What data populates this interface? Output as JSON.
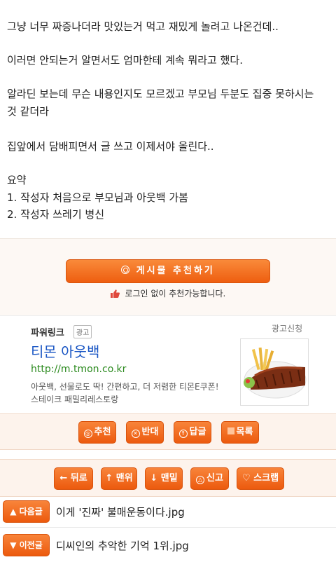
{
  "article": {
    "lines": [
      "그냥 너무 짜증나더라 맛있는거 먹고 재밌게 놀려고 나온건데..",
      "이러면 안되는거 알면서도 엄마한테 계속 뭐라고 했다.",
      "알라딘 보는데 무슨 내용인지도 모르겠고 부모님 두분도 집중 못하시는",
      "것 같더라",
      "집앞에서 담배피면서 글 쓰고 이제서야 올린다..",
      "요약",
      "1. 작성자 처음으로 부모님과 아웃백 가봄",
      "2. 작성자 쓰레기 병신"
    ]
  },
  "recommend": {
    "button_label": "게시물 추천하기",
    "note": "로그인 없이 추천가능합니다."
  },
  "ad": {
    "powerlink": "파워링크",
    "badge": "광고",
    "apply": "광고신청",
    "title": "티몬 아웃백",
    "url": "http://m.tmon.co.kr",
    "desc1": "아웃백, 선물로도 딱! 간편하고, 더 저렴한 티몬E쿠폰!",
    "desc2": "스테이크 패밀리레스토랑"
  },
  "actions_top": {
    "recommend": "추천",
    "oppose": "반대",
    "reply": "답글",
    "list": "목록"
  },
  "actions_bottom": {
    "back": "← 뒤로",
    "top": "↑ 맨위",
    "bottom": "↓ 맨밑",
    "report": "신고",
    "scrap": "♡ 스크랩"
  },
  "nav": {
    "next_label": "▲ 다음글",
    "next_title": "이게 '진짜' 불매운동이다.jpg",
    "prev_label": "▼ 이전글",
    "prev_title": "디씨인의 추악한 기억 1위.jpg"
  },
  "colors": {
    "accent": "#ee5e10",
    "link": "#1a56c4",
    "url": "#2b8a1e"
  }
}
